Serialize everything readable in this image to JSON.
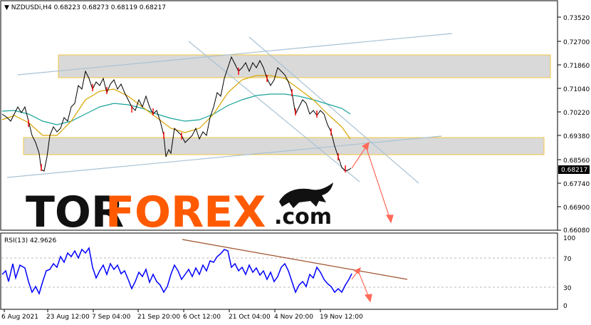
{
  "main_panel": {
    "info": "NZDUSDi,H4  0.68223 0.68273 0.68119 0.68217",
    "price_axis_labels": [
      "0.73520",
      "0.72700",
      "0.71860",
      "0.71040",
      "0.70220",
      "0.69380",
      "0.68560",
      "0.67740",
      "0.66900",
      "0.66080"
    ],
    "current_price_label": "0.68217",
    "current_price_bg": "#000000"
  },
  "rsi_panel": {
    "info": "RSI(13) 42.9626",
    "axis_labels": [
      "100",
      "70",
      "30",
      "0"
    ]
  },
  "time_axis_labels": [
    "6 Aug 2021",
    "23 Aug 12:00",
    "7 Sep 04:00",
    "21 Sep 20:00",
    "6 Oct 12:00",
    "21 Oct 04:00",
    "4 Nov 20:00",
    "19 Nov 12:00"
  ],
  "logo": {
    "part1": "TOR",
    "part2": "FOREX",
    "part3": ".com",
    "color_dark": "#111111",
    "color_orange": "#ff5a00",
    "bull_icon": "bull-icon"
  },
  "colors": {
    "price_line": "#000000",
    "bear_candle": "#ff0000",
    "ma_fast": "#d9a400",
    "ma_slow": "#1aa39a",
    "channel": "#a9c2d4",
    "zone_fill": "#d9d9d9",
    "zone_border": "#f5c842",
    "arrow": "#ff6a5a",
    "rsi_line": "#0000ff",
    "rsi_trend": "#a0522d"
  },
  "chart_data": [
    {
      "type": "line",
      "title": "NZDUSDi,H4",
      "ylim": [
        0.6608,
        0.7352
      ],
      "x": [
        "6 Aug 2021",
        "23 Aug 12:00",
        "7 Sep 04:00",
        "21 Sep 20:00",
        "6 Oct 12:00",
        "21 Oct 04:00",
        "4 Nov 20:00",
        "19 Nov 12:00"
      ],
      "series": [
        {
          "values": [
            0.7035,
            0.6905,
            0.7165,
            0.692,
            0.719,
            0.722,
            0.7,
            0.6821
          ]
        }
      ],
      "zones": [
        [
          0.714,
          0.7215
        ],
        [
          0.6862,
          0.6925
        ]
      ]
    },
    {
      "type": "line",
      "title": "RSI(13) 42.9626",
      "ylim": [
        0,
        100
      ],
      "x": [
        "6 Aug 2021",
        "23 Aug 12:00",
        "7 Sep 04:00",
        "21 Sep 20:00",
        "6 Oct 12:00",
        "21 Oct 04:00",
        "4 Nov 20:00",
        "19 Nov 12:00"
      ],
      "series": [
        {
          "values": [
            46,
            72,
            58,
            40,
            52,
            80,
            50,
            43
          ]
        }
      ],
      "levels": [
        70,
        30
      ]
    }
  ]
}
